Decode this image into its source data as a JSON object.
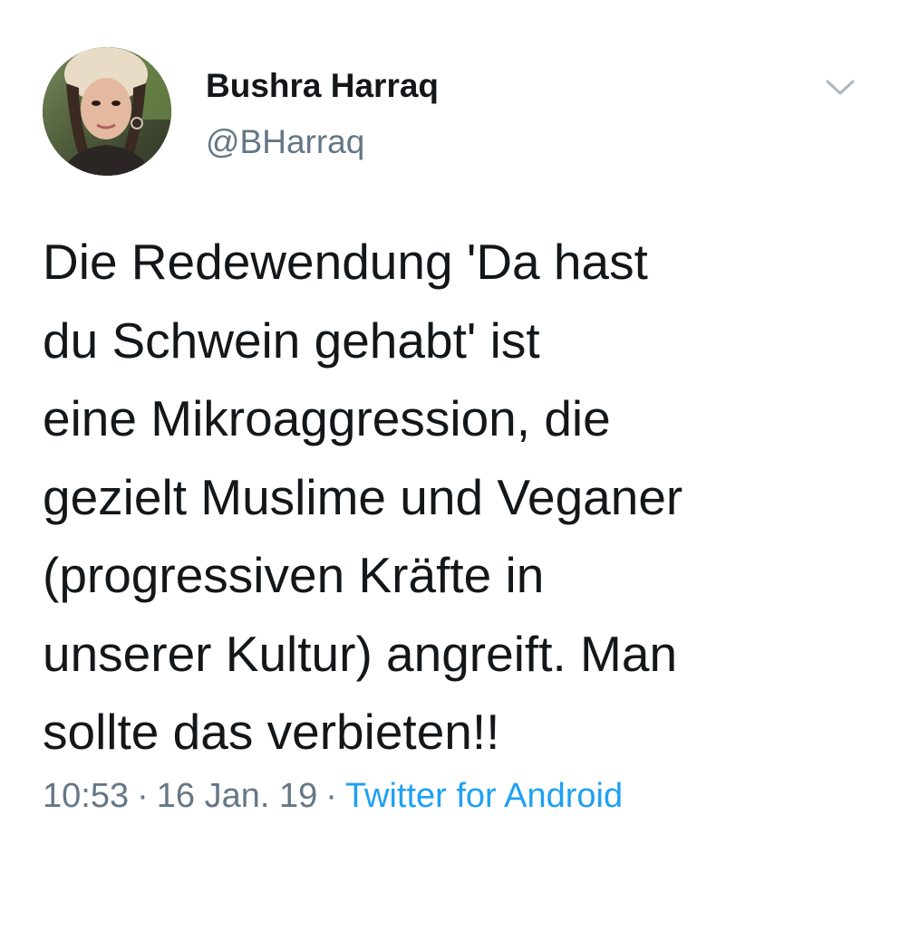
{
  "tweet": {
    "author": {
      "name": "Bushra Harraq",
      "handle": "@BHarraq"
    },
    "text": "Die Redewendung 'Da hast\ndu Schwein gehabt' ist\neine Mikroaggression, die\ngezielt Muslime und Veganer\n(progressiven Kräfte in\nunserer Kultur) angreift. Man\nsollte das verbieten!!",
    "time": "10:53",
    "date": "16 Jan. 19",
    "separator": "·",
    "source": "Twitter for Android",
    "menu_icon": "chevron-down-icon"
  },
  "colors": {
    "text": "#14171a",
    "secondary": "#657786",
    "link": "#1da1f2",
    "chevron": "#aab8c2",
    "background": "#ffffff"
  }
}
